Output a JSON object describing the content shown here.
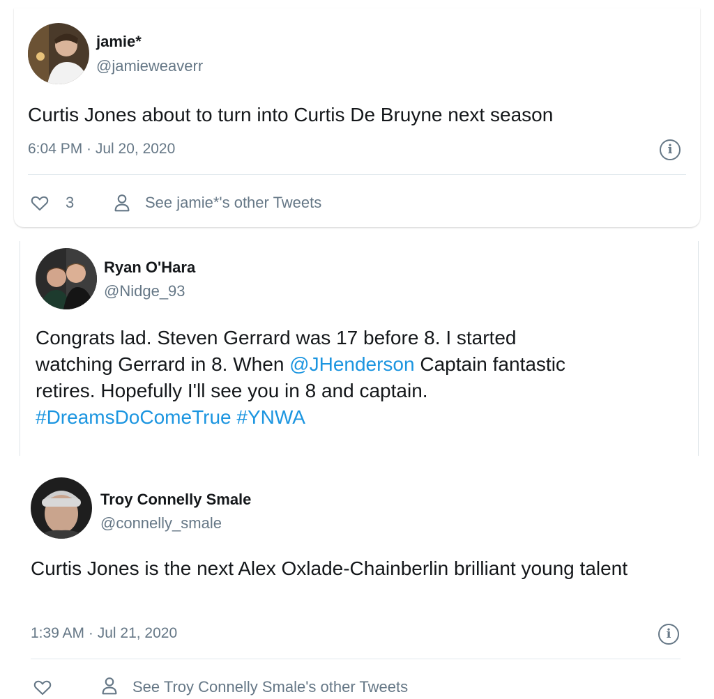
{
  "tweets": [
    {
      "name": "jamie*",
      "handle": "@jamieweaverr",
      "text": "Curtis Jones about to turn into Curtis De Bruyne next season",
      "timestamp": "6:04 PM · Jul 20, 2020",
      "likes": "3",
      "other_tweets": "See jamie*'s other Tweets"
    },
    {
      "name": "Ryan O'Hara",
      "handle": "@Nidge_93",
      "text_line1": "Congrats lad. Steven Gerrard was 17 before 8. I started",
      "text_line2_pre": "watching Gerrard in 8. When ",
      "mention": "@JHenderson",
      "text_line2_post": " Captain fantastic",
      "text_line3": "retires. Hopefully I'll see you in 8 and captain.",
      "hashtag1": "#DreamsDoComeTrue",
      "hashtag2": "#YNWA"
    },
    {
      "name": "Troy Connelly Smale",
      "handle": "@connelly_smale",
      "text": "Curtis Jones is the next Alex Oxlade-Chainberlin brilliant young talent",
      "timestamp": "1:39 AM · Jul 21, 2020",
      "other_tweets": "See Troy Connelly Smale's other Tweets"
    }
  ],
  "colors": {
    "link": "#1b95e0",
    "muted": "#657786",
    "text": "#14171a"
  },
  "icons": [
    "heart-icon",
    "person-icon",
    "info-icon"
  ]
}
